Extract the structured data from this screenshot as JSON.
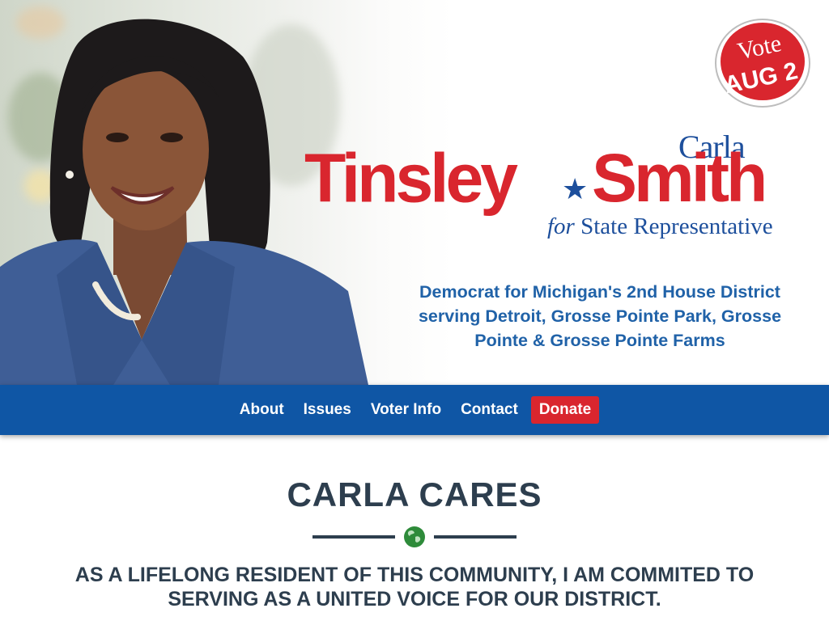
{
  "badge": {
    "line1": "Vote",
    "line2": "AUG 2"
  },
  "logo": {
    "first_name": "Carla",
    "last_name_1": "Tinsley",
    "star": "★",
    "last_name_2": "Smith",
    "for_word": "for",
    "office": "State Representative"
  },
  "tagline": "Democrat for Michigan's 2nd House District serving Detroit, Grosse Pointe Park, Grosse Pointe & Grosse Pointe Farms",
  "nav": {
    "items": [
      {
        "label": "About"
      },
      {
        "label": "Issues"
      },
      {
        "label": "Voter Info"
      },
      {
        "label": "Contact"
      }
    ],
    "donate": "Donate"
  },
  "section": {
    "title": "CARLA CARES",
    "icon": "globe-icon",
    "statement": "AS A LIFELONG RESIDENT OF THIS COMMUNITY, I AM COMMITED TO SERVING AS A UNITED VOICE FOR OUR DISTRICT."
  },
  "colors": {
    "red": "#d9262e",
    "blue": "#0f56a5",
    "dark": "#2d3e4e",
    "green": "#2e8b3a"
  }
}
